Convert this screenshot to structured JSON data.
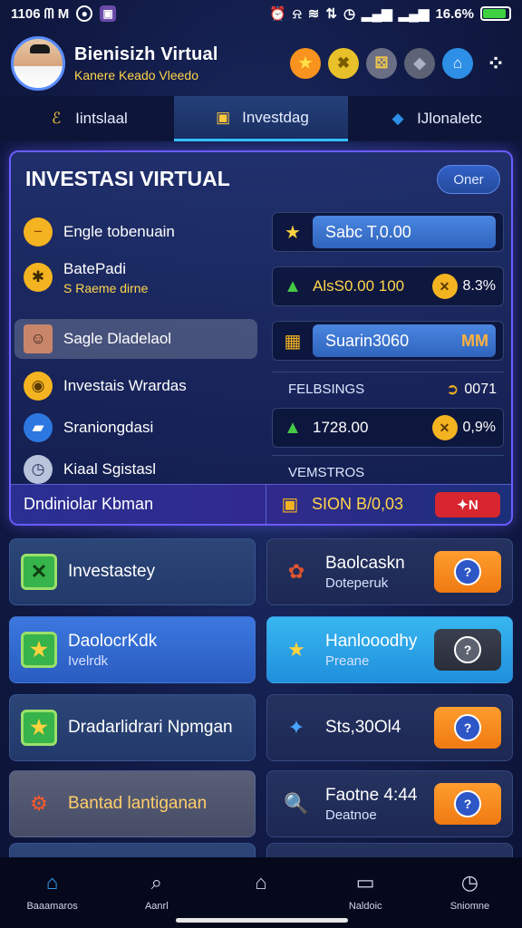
{
  "status": {
    "time": "1106 ᗰ M",
    "right_text": "16.6%",
    "battery_percent": 90,
    "icons": [
      "camera-icon",
      "gallery-icon",
      "alarm-icon",
      "vibrate-icon",
      "wifi-icon",
      "data-icon",
      "clock-icon",
      "signal-icon",
      "signal-icon-2"
    ]
  },
  "header": {
    "title": "Bienisizh Virtual",
    "subtitle": "Kanere Keado Vleedo",
    "icons": [
      {
        "name": "star-icon",
        "glyph": "★",
        "bg": "#f7931e",
        "fg": "#ffe14a"
      },
      {
        "name": "cross-swords-icon",
        "glyph": "✖",
        "bg": "#e8c12a",
        "fg": "#7a5b00"
      },
      {
        "name": "dice-icon",
        "glyph": "⚄",
        "bg": "#6b6f85",
        "fg": "#f2c94c"
      },
      {
        "name": "cube-icon",
        "glyph": "◆",
        "bg": "#5d6275",
        "fg": "#a9b1c6"
      },
      {
        "name": "bank-icon",
        "glyph": "⌂",
        "bg": "#2d8fe6",
        "fg": "#ffffff"
      },
      {
        "name": "more-dots-icon",
        "glyph": "⁘",
        "bg": "transparent",
        "fg": "#ffffff"
      }
    ]
  },
  "tabs": [
    {
      "label": "Iintslaal",
      "icon": "ℰ",
      "color": "#ffc83d",
      "active": false
    },
    {
      "label": "Investdag",
      "icon": "▣",
      "color": "#ffc83d",
      "active": true
    },
    {
      "label": "IJlonaletc",
      "icon": "◆",
      "color": "#2d8fe6",
      "active": false
    }
  ],
  "panel": {
    "title": "INVESTASI VIRTUAL",
    "open_label": "Oner",
    "left_items": [
      {
        "label": "Engle tobenuain",
        "sub": "",
        "glyph": "−",
        "bg": "#f4b321",
        "fg": "#8a4a00",
        "selected": false
      },
      {
        "label": "BatePadi",
        "sub": "S Raeme dirne",
        "glyph": "✱",
        "bg": "#f4b321",
        "fg": "#3b2a00",
        "selected": false
      },
      {
        "label": "Sagle Dladelaol",
        "sub": "",
        "glyph": "☺",
        "bg": "#c9856a",
        "fg": "#2a1a12",
        "selected": true
      },
      {
        "label": "Investais Wrardas",
        "sub": "",
        "glyph": "◉",
        "bg": "#f4b321",
        "fg": "#5a3a00",
        "selected": false
      },
      {
        "label": "Sraniongdasi",
        "sub": "",
        "glyph": "▰",
        "bg": "#2d78e0",
        "fg": "#ffffff",
        "selected": false
      },
      {
        "label": "Kiaal Sgistasl",
        "sub": "",
        "glyph": "◷",
        "bg": "#b9c4dc",
        "fg": "#26315a",
        "selected": false
      }
    ],
    "right_rows": [
      {
        "type": "pill",
        "icon": "★",
        "icon_color": "#ffd23f",
        "value": "Sabc T,0.00",
        "badge": ""
      },
      {
        "type": "text",
        "icon": "▲",
        "icon_color": "#46c946",
        "value": "AlsS0.00 100",
        "badge": "8.3%",
        "badge_glyph": "✕"
      },
      {
        "type": "pill",
        "icon": "▦",
        "icon_color": "#f4b321",
        "value": "Suarin3060",
        "badge": "MM"
      },
      {
        "type": "plain",
        "icon": "",
        "icon_color": "",
        "value": "FELBSINGS",
        "badge": "0071",
        "badge_glyph": "➲"
      },
      {
        "type": "text",
        "icon": "▲",
        "icon_color": "#46c946",
        "value": "1728.00",
        "badge": "0,9%",
        "badge_glyph": "✕"
      },
      {
        "type": "plain",
        "icon": "",
        "icon_color": "",
        "value": "VEMSTROS",
        "badge": ""
      }
    ],
    "footer_left": "Dndiniolar Kbman",
    "footer_value": "SION B/0,03",
    "footer_badge": "✦N"
  },
  "cards": [
    {
      "side": "l",
      "style": "",
      "icon": "✕",
      "icon_type": "green",
      "title": "Investastey",
      "sub": "",
      "button": false
    },
    {
      "side": "r",
      "style": "",
      "icon": "✿",
      "icon_type": "plain",
      "icon_color": "#e0542e",
      "title": "Baolcaskn",
      "sub": "Doteperuk",
      "button": true,
      "dark": false
    },
    {
      "side": "l",
      "style": "blue",
      "icon": "★",
      "icon_type": "green",
      "title": "DaolocrKdk",
      "sub": "Ivelrdk",
      "button": false
    },
    {
      "side": "r",
      "style": "cyan",
      "icon": "★",
      "icon_type": "plain",
      "icon_color": "#ffd23f",
      "title": "Hanlooodhy",
      "sub": "Preane",
      "button": true,
      "dark": true
    },
    {
      "side": "l",
      "style": "",
      "icon": "★",
      "icon_type": "green",
      "title": "Dradarlidrari Npmgan",
      "sub": "",
      "button": false
    },
    {
      "side": "r",
      "style": "",
      "icon": "✦",
      "icon_type": "plain",
      "icon_color": "#4aa3ff",
      "title": "Sts,30Ol4",
      "sub": "",
      "button": true,
      "dark": false
    },
    {
      "side": "l",
      "style": "grey",
      "icon": "⚙",
      "icon_type": "plain",
      "icon_color": "#ff5a2a",
      "title": "Bantad lantiganan",
      "sub": "",
      "button": false,
      "title_color": "#ffcf6b"
    },
    {
      "side": "r",
      "style": "",
      "icon": "🔍",
      "icon_type": "plain",
      "icon_color": "#3a8fe6",
      "title": "Faotne 4:44",
      "sub": "Deatnoe",
      "button": true,
      "dark": false
    }
  ],
  "nav": [
    {
      "label": "Baaamaros",
      "glyph": "⌂",
      "active": true
    },
    {
      "label": "Aanrl",
      "glyph": "⌕",
      "active": false
    },
    {
      "label": "",
      "glyph": "⌂",
      "active": false
    },
    {
      "label": "Naldoic",
      "glyph": "▭",
      "active": false
    },
    {
      "label": "Sniomne",
      "glyph": "◷",
      "active": false
    }
  ]
}
